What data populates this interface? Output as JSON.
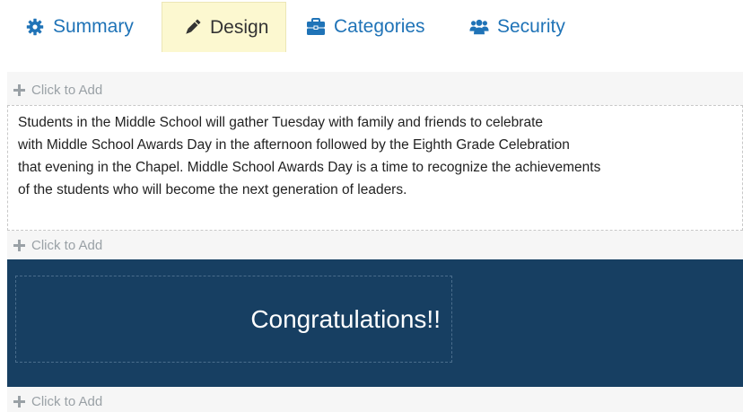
{
  "tabs": [
    {
      "label": "Summary",
      "icon": "gear-icon",
      "active": false
    },
    {
      "label": "Design",
      "icon": "pencil-icon",
      "active": true
    },
    {
      "label": "Categories",
      "icon": "briefcase-icon",
      "active": false
    },
    {
      "label": "Security",
      "icon": "users-icon",
      "active": false
    }
  ],
  "editor": {
    "add_label": "Click to Add",
    "text_block": {
      "lines": [
        "Students in the Middle School will gather Tuesday with family and friends to celebrate",
        "with Middle School Awards Day in the afternoon followed by the Eighth Grade Celebration",
        "that evening in the Chapel. Middle School Awards Day is a time to recognize the achievements",
        "of the students who will become the next generation of leaders."
      ]
    },
    "banner": {
      "title": "Congratulations!!",
      "background": "#173f62"
    }
  },
  "colors": {
    "tab_link": "#1f73b7",
    "active_tab_bg": "#fcf8d0",
    "add_row_text": "#9aa1a6"
  }
}
